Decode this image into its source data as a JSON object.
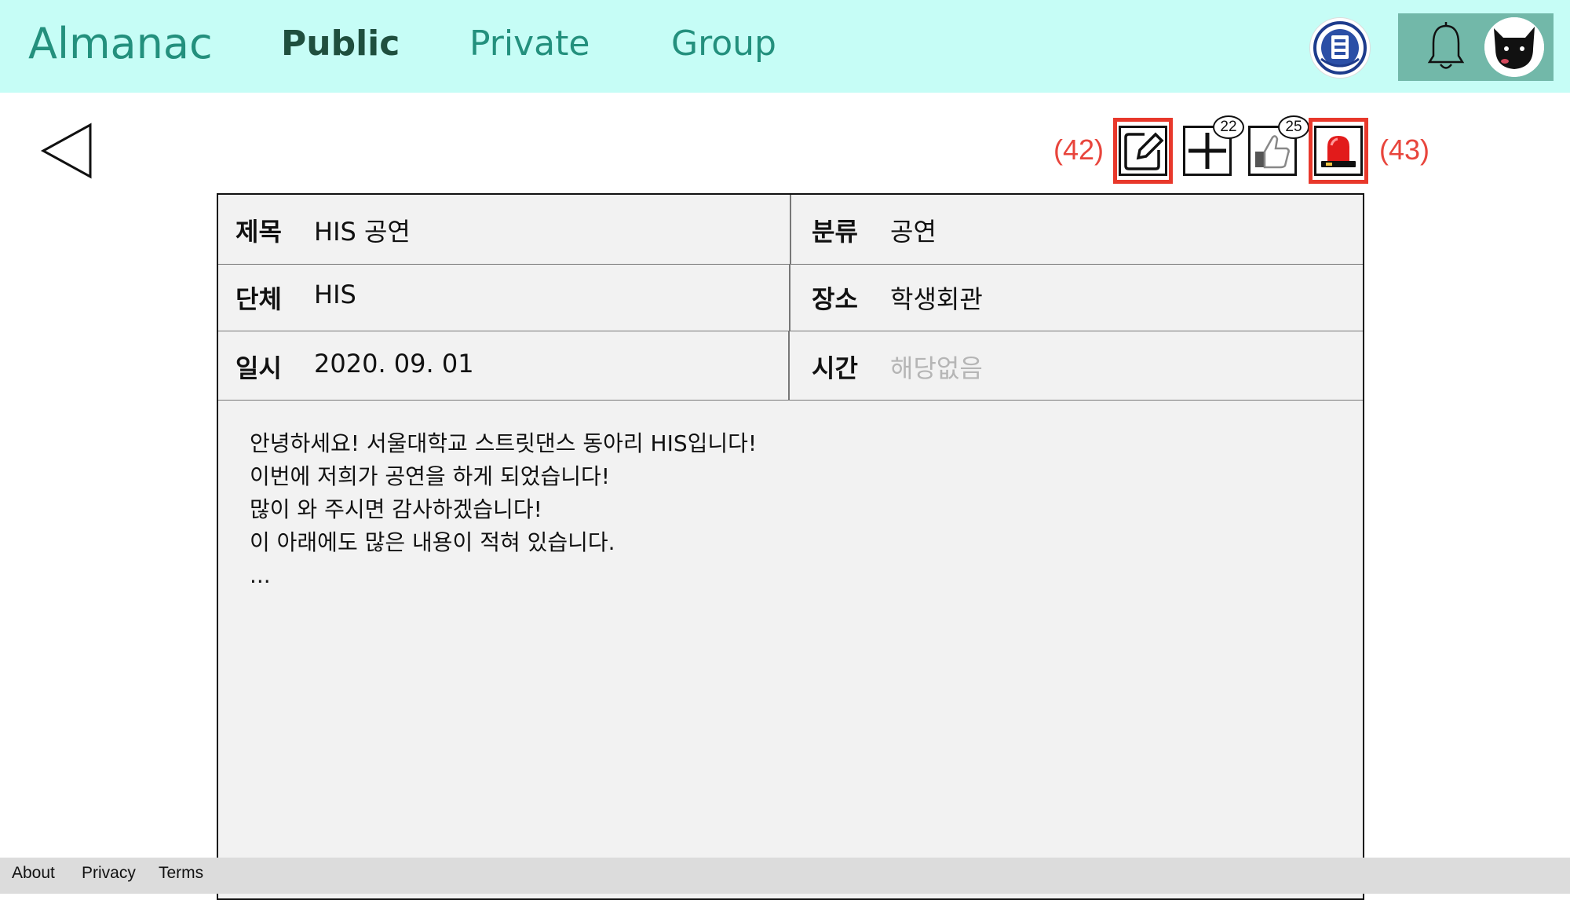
{
  "app": {
    "title": "Almanac"
  },
  "nav": {
    "public": "Public",
    "private": "Private",
    "group": "Group"
  },
  "toolbar": {
    "annotation_left": "(42)",
    "annotation_right": "(43)",
    "add_count": "22",
    "like_count": "25"
  },
  "post": {
    "title_label": "제목",
    "title_value": "HIS 공연",
    "category_label": "분류",
    "category_value": "공연",
    "group_label": "단체",
    "group_value": "HIS",
    "place_label": "장소",
    "place_value": "학생회관",
    "date_label": "일시",
    "date_value": "2020. 09. 01",
    "time_label": "시간",
    "time_value": "해당없음",
    "body_lines": [
      "안녕하세요! 서울대학교 스트릿댄스 동아리 HIS입니다!",
      "이번에 저희가 공연을 하게 되었습니다!",
      "많이 와 주시면 감사하겠습니다!",
      "이 아래에도 많은 내용이 적혀 있습니다.",
      "..."
    ]
  },
  "footer": {
    "about": "About",
    "privacy": "Privacy",
    "terms": "Terms"
  },
  "colors": {
    "header_bg": "#c6fdf6",
    "brand": "#23907d",
    "nav_active": "#1f4f3e",
    "user_box": "#72b8a9",
    "annotation_red": "#e8453c",
    "post_bg": "#f2f2f2",
    "muted_text": "#b5b5b5"
  },
  "icons": {
    "back": "back-arrow-icon",
    "edit": "edit-icon",
    "add": "plus-icon",
    "like": "thumbs-up-icon",
    "report": "siren-icon",
    "bell": "bell-icon",
    "avatar": "dog-avatar",
    "emblem": "university-emblem"
  }
}
